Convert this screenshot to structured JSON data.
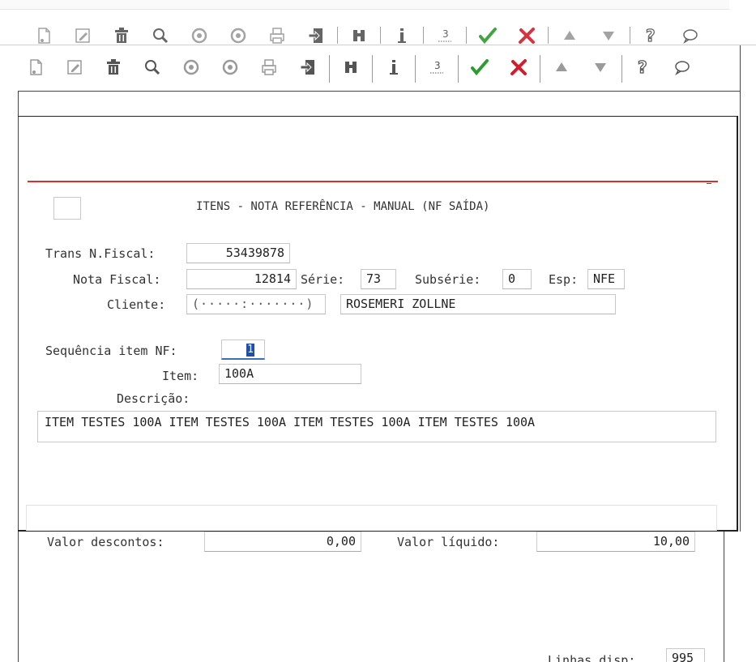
{
  "toolbar": {
    "buttons": [
      {
        "icon": "new-document-icon"
      },
      {
        "icon": "edit-icon"
      },
      {
        "icon": "trash-icon"
      },
      {
        "icon": "search-icon"
      },
      {
        "icon": "previous-icon"
      },
      {
        "icon": "next-icon"
      },
      {
        "icon": "print-icon"
      },
      {
        "icon": "exit-icon"
      },
      {
        "icon": "binoculars-icon"
      },
      {
        "icon": "info-icon"
      },
      {
        "icon": "numbered-icon"
      },
      {
        "icon": "confirm-icon"
      },
      {
        "icon": "cancel-icon"
      },
      {
        "icon": "arrow-up-icon"
      },
      {
        "icon": "arrow-down-icon"
      },
      {
        "icon": "help-icon"
      },
      {
        "icon": "comment-icon"
      }
    ],
    "colors": {
      "confirm": "#2e9b2e",
      "cancel": "#d21d2c",
      "icon_gray": "#9a9a9a",
      "icon_dark": "#555555"
    }
  },
  "screen": {
    "title": "ITENS - NOTA REFERÊNCIA - MANUAL (NF SAÍDA)",
    "accent_line_color": "#d9302c"
  },
  "form": {
    "trans_nf_label": "Trans N.Fiscal:",
    "trans_nf_value": "53439878",
    "nota_fiscal_label": "Nota Fiscal:",
    "nota_fiscal_value": "12814",
    "serie_label": "Série:",
    "serie_value": "73",
    "subserie_label": "Subsérie:",
    "subserie_value": "0",
    "esp_label": "Esp:",
    "esp_value": "NFE",
    "cliente_label": "Cliente:",
    "cliente_code": "(·····:·······)",
    "cliente_name": "ROSEMERI ZOLLNE",
    "seq_label": "Sequência item NF:",
    "seq_value": "1",
    "item_label": "Item:",
    "item_value": "100A",
    "descricao_label": "Descrição:",
    "descricao_value": "ITEM TESTES 100A ITEM TESTES 100A ITEM TESTES 100A ITEM TESTES 100A",
    "valor_descontos_label": "Valor descontos:",
    "valor_descontos_value": "0,00",
    "valor_liquido_label": "Valor líquido:",
    "valor_liquido_value": "10,00",
    "linhas_disp_label": "Linhas disp:",
    "linhas_disp_value": "995"
  }
}
